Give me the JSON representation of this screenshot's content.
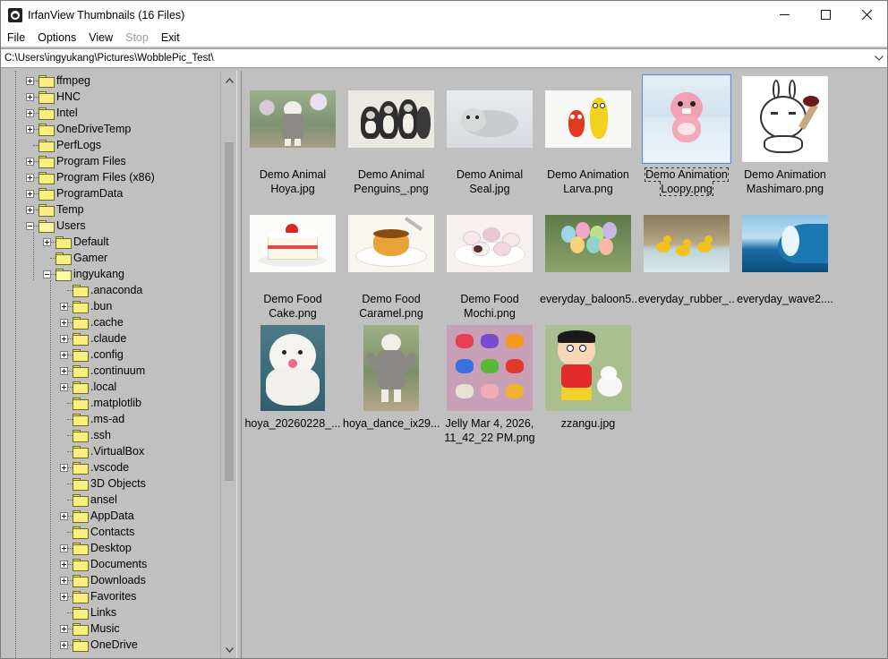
{
  "window": {
    "title": "IrfanView Thumbnails (16 Files)"
  },
  "menu": {
    "file": "File",
    "options": "Options",
    "view": "View",
    "stop": "Stop",
    "exit": "Exit"
  },
  "path": {
    "value": "C:\\Users\\ingyukang\\Pictures\\WobblePic_Test\\"
  },
  "tree": {
    "items": [
      {
        "label": "ffmpeg",
        "expander": "plus"
      },
      {
        "label": "HNC",
        "expander": "plus"
      },
      {
        "label": "Intel",
        "expander": "plus"
      },
      {
        "label": "OneDriveTemp",
        "expander": "plus"
      },
      {
        "label": "PerfLogs",
        "expander": "none"
      },
      {
        "label": "Program Files",
        "expander": "plus"
      },
      {
        "label": "Program Files (x86)",
        "expander": "plus"
      },
      {
        "label": "ProgramData",
        "expander": "plus"
      },
      {
        "label": "Temp",
        "expander": "plus"
      },
      {
        "label": "Users",
        "expander": "minus"
      },
      {
        "label": "Default",
        "expander": "plus"
      },
      {
        "label": "Gamer",
        "expander": "none"
      },
      {
        "label": "ingyukang",
        "expander": "minus"
      },
      {
        "label": ".anaconda",
        "expander": "none"
      },
      {
        "label": ".bun",
        "expander": "plus"
      },
      {
        "label": ".cache",
        "expander": "plus"
      },
      {
        "label": ".claude",
        "expander": "plus"
      },
      {
        "label": ".config",
        "expander": "plus"
      },
      {
        "label": ".continuum",
        "expander": "plus"
      },
      {
        "label": ".local",
        "expander": "plus"
      },
      {
        "label": ".matplotlib",
        "expander": "none"
      },
      {
        "label": ".ms-ad",
        "expander": "none"
      },
      {
        "label": ".ssh",
        "expander": "none"
      },
      {
        "label": ".VirtualBox",
        "expander": "none"
      },
      {
        "label": ".vscode",
        "expander": "plus"
      },
      {
        "label": "3D Objects",
        "expander": "none"
      },
      {
        "label": "ansel",
        "expander": "none"
      },
      {
        "label": "AppData",
        "expander": "plus"
      },
      {
        "label": "Contacts",
        "expander": "none"
      },
      {
        "label": "Desktop",
        "expander": "plus"
      },
      {
        "label": "Documents",
        "expander": "plus"
      },
      {
        "label": "Downloads",
        "expander": "plus"
      },
      {
        "label": "Favorites",
        "expander": "plus"
      },
      {
        "label": "Links",
        "expander": "none"
      },
      {
        "label": "Music",
        "expander": "plus"
      },
      {
        "label": "OneDrive",
        "expander": "plus"
      }
    ]
  },
  "thumbnails": [
    {
      "label": "Demo Animal\nHoya.jpg",
      "image": "white-dog-standing"
    },
    {
      "label": "Demo Animal\nPenguins_.png",
      "image": "penguins"
    },
    {
      "label": "Demo Animal\nSeal.jpg",
      "image": "seal"
    },
    {
      "label": "Demo Animation\nLarva.png",
      "image": "larva-cartoon"
    },
    {
      "label": "Demo Animation\nLoopy.png",
      "image": "pink-beaver-cartoon",
      "selected": true
    },
    {
      "label": "Demo Animation\nMashimaro.png",
      "image": "rabbit-cartoon"
    },
    {
      "label": "Demo Food\nCake.png",
      "image": "strawberry-cake"
    },
    {
      "label": "Demo Food\nCaramel.png",
      "image": "caramel-pudding"
    },
    {
      "label": "Demo Food\nMochi.png",
      "image": "mochi"
    },
    {
      "label": "everyday_baloon5...",
      "image": "balloons"
    },
    {
      "label": "everyday_rubber_...",
      "image": "rubber-ducks"
    },
    {
      "label": "everyday_wave2....",
      "image": "ocean-wave"
    },
    {
      "label": "hoya_20260228_...",
      "image": "white-dog-sitting"
    },
    {
      "label": "hoya_dance_ix29...",
      "image": "white-dog-dancing"
    },
    {
      "label": "Jelly Mar 4, 2026,\n11_42_22 PM.png",
      "image": "jelly-candies"
    },
    {
      "label": "zzangu.jpg",
      "image": "cartoon-boy-and-dog"
    }
  ],
  "colors": {
    "background": "#c0c0c0",
    "selection_border": "#5a8fd8",
    "selection_fill": "#cfe1f7",
    "folder": "#fbf07d"
  }
}
